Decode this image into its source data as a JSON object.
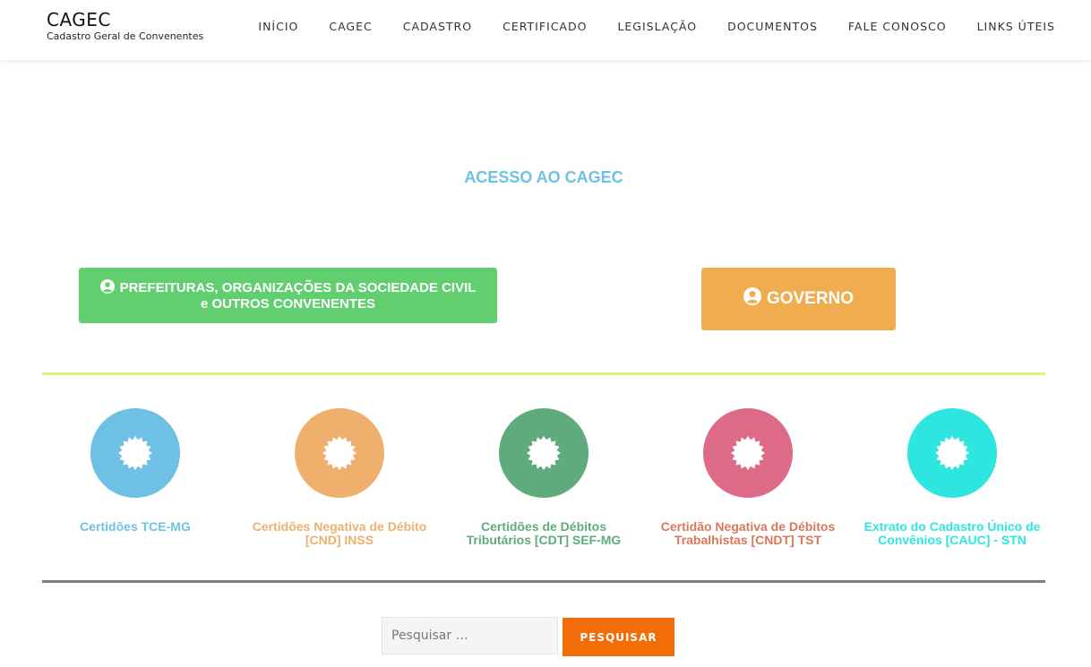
{
  "site": {
    "title": "CAGEC",
    "subtitle": "Cadastro Geral de Convenentes"
  },
  "nav": [
    "INÍCIO",
    "CAGEC",
    "CADASTRO",
    "CERTIFICADO",
    "LEGISLAÇÃO",
    "DOCUMENTOS",
    "FALE CONOSCO",
    "LINKS ÚTEIS"
  ],
  "section": {
    "title": "ACESSO AO CAGEC"
  },
  "access_buttons": {
    "prefeituras": {
      "line1": "PREFEITURAS, ORGANIZAÇÕES DA SOCIEDADE CIVIL",
      "line2": "e OUTROS CONVENENTES",
      "icon": "user-circle-icon"
    },
    "governo": {
      "label": "GOVERNO",
      "icon": "user-circle-icon"
    }
  },
  "certificates": [
    {
      "line1": "Certidões TCE-MG",
      "line2": "",
      "color": "#6ec1e4",
      "icon": "badge-icon"
    },
    {
      "line1": "Certidões Negativa de Débito",
      "line2": "[CND] INSS",
      "color": "#efb06e",
      "icon": "badge-icon"
    },
    {
      "line1": "Certidões de Débitos",
      "line2": "Tributários [CDT] SEF-MG",
      "color": "#5fab7c",
      "icon": "badge-icon"
    },
    {
      "line1": "Certidão Negativa de Débitos",
      "line2": "Trabalhistas [CNDT] TST",
      "color": "#dd6b87",
      "icon": "badge-icon"
    },
    {
      "line1": "Extrato do Cadastro Único de",
      "line2": "Convênios [CAUC] - STN",
      "color": "#2ee6df",
      "icon": "badge-icon"
    }
  ],
  "cert_label_colors": [
    "#6ec1e4",
    "#efb06e",
    "#5fab7c",
    "#d9775a",
    "#2ee6df"
  ],
  "search": {
    "placeholder": "Pesquisar …",
    "button": "PESQUISAR"
  },
  "colors": {
    "title": "#6ec1e4",
    "prefeituras_button": "#61ce70",
    "governo_button": "#efad4f",
    "divider_top": "#e5ee7a",
    "divider_bottom": "#808080",
    "search_button": "#f26c07"
  }
}
